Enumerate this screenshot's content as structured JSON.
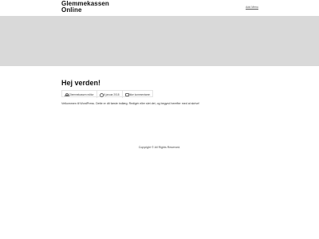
{
  "site": {
    "title_line1": "Glemmekassen",
    "title_line2": "Online",
    "add_menu": "Add Menu"
  },
  "post": {
    "title": "Hej verden!",
    "meta": {
      "author": "Glemmekassen editor",
      "date": "6 januar 2018",
      "comments": "Ikke kommentaren"
    },
    "body": "Velkommen til WordPress. Dette er dit første indlæg. Redigér eller slet det, og begynd herefter med at skrive!"
  },
  "footer": {
    "copyright": "Copyright © All Rights Reserved."
  },
  "colors": {
    "hero_background": "#d9d9d9"
  }
}
